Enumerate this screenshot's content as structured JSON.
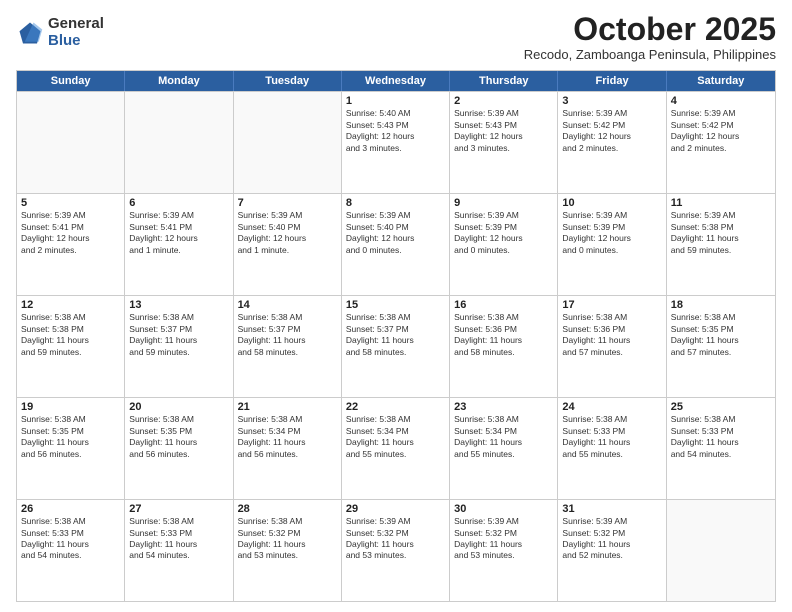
{
  "logo": {
    "general": "General",
    "blue": "Blue"
  },
  "header": {
    "month": "October 2025",
    "location": "Recodo, Zamboanga Peninsula, Philippines"
  },
  "weekdays": [
    "Sunday",
    "Monday",
    "Tuesday",
    "Wednesday",
    "Thursday",
    "Friday",
    "Saturday"
  ],
  "rows": [
    [
      {
        "day": "",
        "lines": [],
        "empty": true
      },
      {
        "day": "",
        "lines": [],
        "empty": true
      },
      {
        "day": "",
        "lines": [],
        "empty": true
      },
      {
        "day": "1",
        "lines": [
          "Sunrise: 5:40 AM",
          "Sunset: 5:43 PM",
          "Daylight: 12 hours",
          "and 3 minutes."
        ],
        "empty": false
      },
      {
        "day": "2",
        "lines": [
          "Sunrise: 5:39 AM",
          "Sunset: 5:43 PM",
          "Daylight: 12 hours",
          "and 3 minutes."
        ],
        "empty": false
      },
      {
        "day": "3",
        "lines": [
          "Sunrise: 5:39 AM",
          "Sunset: 5:42 PM",
          "Daylight: 12 hours",
          "and 2 minutes."
        ],
        "empty": false
      },
      {
        "day": "4",
        "lines": [
          "Sunrise: 5:39 AM",
          "Sunset: 5:42 PM",
          "Daylight: 12 hours",
          "and 2 minutes."
        ],
        "empty": false
      }
    ],
    [
      {
        "day": "5",
        "lines": [
          "Sunrise: 5:39 AM",
          "Sunset: 5:41 PM",
          "Daylight: 12 hours",
          "and 2 minutes."
        ],
        "empty": false
      },
      {
        "day": "6",
        "lines": [
          "Sunrise: 5:39 AM",
          "Sunset: 5:41 PM",
          "Daylight: 12 hours",
          "and 1 minute."
        ],
        "empty": false
      },
      {
        "day": "7",
        "lines": [
          "Sunrise: 5:39 AM",
          "Sunset: 5:40 PM",
          "Daylight: 12 hours",
          "and 1 minute."
        ],
        "empty": false
      },
      {
        "day": "8",
        "lines": [
          "Sunrise: 5:39 AM",
          "Sunset: 5:40 PM",
          "Daylight: 12 hours",
          "and 0 minutes."
        ],
        "empty": false
      },
      {
        "day": "9",
        "lines": [
          "Sunrise: 5:39 AM",
          "Sunset: 5:39 PM",
          "Daylight: 12 hours",
          "and 0 minutes."
        ],
        "empty": false
      },
      {
        "day": "10",
        "lines": [
          "Sunrise: 5:39 AM",
          "Sunset: 5:39 PM",
          "Daylight: 12 hours",
          "and 0 minutes."
        ],
        "empty": false
      },
      {
        "day": "11",
        "lines": [
          "Sunrise: 5:39 AM",
          "Sunset: 5:38 PM",
          "Daylight: 11 hours",
          "and 59 minutes."
        ],
        "empty": false
      }
    ],
    [
      {
        "day": "12",
        "lines": [
          "Sunrise: 5:38 AM",
          "Sunset: 5:38 PM",
          "Daylight: 11 hours",
          "and 59 minutes."
        ],
        "empty": false
      },
      {
        "day": "13",
        "lines": [
          "Sunrise: 5:38 AM",
          "Sunset: 5:37 PM",
          "Daylight: 11 hours",
          "and 59 minutes."
        ],
        "empty": false
      },
      {
        "day": "14",
        "lines": [
          "Sunrise: 5:38 AM",
          "Sunset: 5:37 PM",
          "Daylight: 11 hours",
          "and 58 minutes."
        ],
        "empty": false
      },
      {
        "day": "15",
        "lines": [
          "Sunrise: 5:38 AM",
          "Sunset: 5:37 PM",
          "Daylight: 11 hours",
          "and 58 minutes."
        ],
        "empty": false
      },
      {
        "day": "16",
        "lines": [
          "Sunrise: 5:38 AM",
          "Sunset: 5:36 PM",
          "Daylight: 11 hours",
          "and 58 minutes."
        ],
        "empty": false
      },
      {
        "day": "17",
        "lines": [
          "Sunrise: 5:38 AM",
          "Sunset: 5:36 PM",
          "Daylight: 11 hours",
          "and 57 minutes."
        ],
        "empty": false
      },
      {
        "day": "18",
        "lines": [
          "Sunrise: 5:38 AM",
          "Sunset: 5:35 PM",
          "Daylight: 11 hours",
          "and 57 minutes."
        ],
        "empty": false
      }
    ],
    [
      {
        "day": "19",
        "lines": [
          "Sunrise: 5:38 AM",
          "Sunset: 5:35 PM",
          "Daylight: 11 hours",
          "and 56 minutes."
        ],
        "empty": false
      },
      {
        "day": "20",
        "lines": [
          "Sunrise: 5:38 AM",
          "Sunset: 5:35 PM",
          "Daylight: 11 hours",
          "and 56 minutes."
        ],
        "empty": false
      },
      {
        "day": "21",
        "lines": [
          "Sunrise: 5:38 AM",
          "Sunset: 5:34 PM",
          "Daylight: 11 hours",
          "and 56 minutes."
        ],
        "empty": false
      },
      {
        "day": "22",
        "lines": [
          "Sunrise: 5:38 AM",
          "Sunset: 5:34 PM",
          "Daylight: 11 hours",
          "and 55 minutes."
        ],
        "empty": false
      },
      {
        "day": "23",
        "lines": [
          "Sunrise: 5:38 AM",
          "Sunset: 5:34 PM",
          "Daylight: 11 hours",
          "and 55 minutes."
        ],
        "empty": false
      },
      {
        "day": "24",
        "lines": [
          "Sunrise: 5:38 AM",
          "Sunset: 5:33 PM",
          "Daylight: 11 hours",
          "and 55 minutes."
        ],
        "empty": false
      },
      {
        "day": "25",
        "lines": [
          "Sunrise: 5:38 AM",
          "Sunset: 5:33 PM",
          "Daylight: 11 hours",
          "and 54 minutes."
        ],
        "empty": false
      }
    ],
    [
      {
        "day": "26",
        "lines": [
          "Sunrise: 5:38 AM",
          "Sunset: 5:33 PM",
          "Daylight: 11 hours",
          "and 54 minutes."
        ],
        "empty": false
      },
      {
        "day": "27",
        "lines": [
          "Sunrise: 5:38 AM",
          "Sunset: 5:33 PM",
          "Daylight: 11 hours",
          "and 54 minutes."
        ],
        "empty": false
      },
      {
        "day": "28",
        "lines": [
          "Sunrise: 5:38 AM",
          "Sunset: 5:32 PM",
          "Daylight: 11 hours",
          "and 53 minutes."
        ],
        "empty": false
      },
      {
        "day": "29",
        "lines": [
          "Sunrise: 5:39 AM",
          "Sunset: 5:32 PM",
          "Daylight: 11 hours",
          "and 53 minutes."
        ],
        "empty": false
      },
      {
        "day": "30",
        "lines": [
          "Sunrise: 5:39 AM",
          "Sunset: 5:32 PM",
          "Daylight: 11 hours",
          "and 53 minutes."
        ],
        "empty": false
      },
      {
        "day": "31",
        "lines": [
          "Sunrise: 5:39 AM",
          "Sunset: 5:32 PM",
          "Daylight: 11 hours",
          "and 52 minutes."
        ],
        "empty": false
      },
      {
        "day": "",
        "lines": [],
        "empty": true
      }
    ]
  ]
}
